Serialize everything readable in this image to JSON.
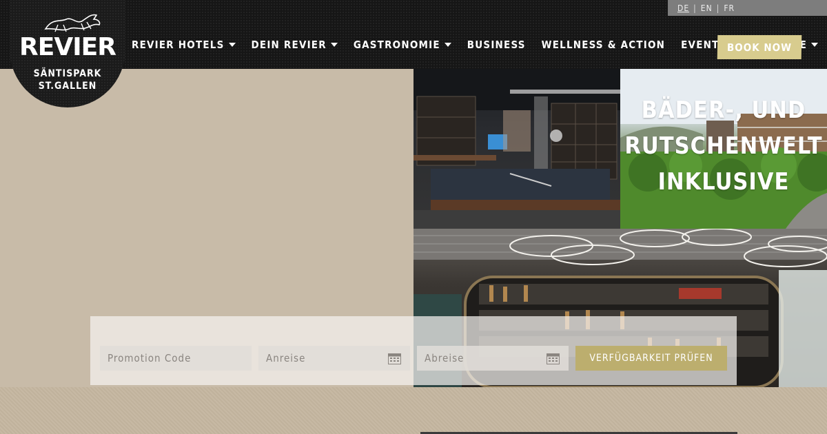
{
  "language_bar": {
    "languages": [
      "DE",
      "EN",
      "FR"
    ],
    "active": "DE",
    "separator": "|"
  },
  "logo": {
    "word": "REVIER",
    "line1": "SÄNTISPARK",
    "line2": "ST.GALLEN",
    "icon": "horse-icon"
  },
  "nav": {
    "items": [
      {
        "label": "REVIER HOTELS",
        "has_dropdown": true
      },
      {
        "label": "DEIN REVIER",
        "has_dropdown": true
      },
      {
        "label": "GASTRONOMIE",
        "has_dropdown": true
      },
      {
        "label": "BUSINESS",
        "has_dropdown": false
      },
      {
        "label": "WELLNESS & ACTION",
        "has_dropdown": false
      },
      {
        "label": "EVENTS & ANGEBOTE",
        "has_dropdown": true
      }
    ],
    "book_label": "BOOK NOW"
  },
  "hero": {
    "promo_line1": "BÄDER-, UND",
    "promo_line2": "RUTSCHENWELT",
    "promo_line3": "INKLUSIVE"
  },
  "booking": {
    "promo_placeholder": "Promotion Code",
    "arrival_placeholder": "Anreise",
    "departure_placeholder": "Abreise",
    "check_label": "VERFÜGBARKEIT PRÜFEN",
    "calendar_icon": "calendar-icon"
  },
  "colors": {
    "header_bg": "#161616",
    "accent_gold": "#d8cc8e",
    "page_bg": "#c8bba8",
    "button_gold": "#bcae6e"
  }
}
